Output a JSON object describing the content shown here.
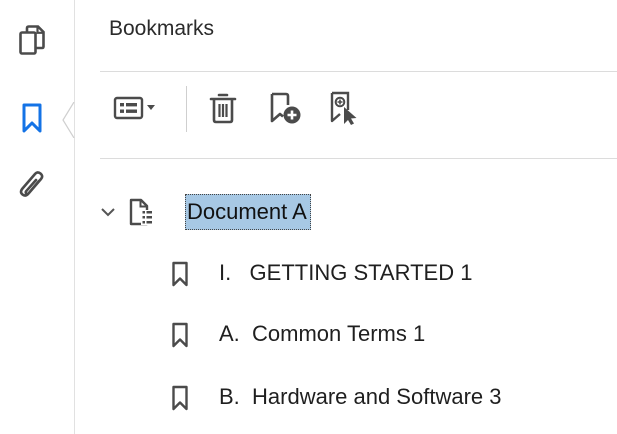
{
  "panel": {
    "title": "Bookmarks"
  },
  "rail": {
    "items": [
      {
        "icon": "page-thumbnails-icon"
      },
      {
        "icon": "bookmark-icon",
        "active": true
      },
      {
        "icon": "attachment-icon"
      }
    ]
  },
  "toolbar": {
    "items": [
      {
        "icon": "options-menu-icon"
      },
      {
        "icon": "delete-icon"
      },
      {
        "icon": "new-bookmark-icon"
      },
      {
        "icon": "find-bookmark-icon"
      }
    ]
  },
  "tree": {
    "root": {
      "label": "Document A",
      "expanded": true,
      "selected": true
    },
    "children": [
      {
        "label": "I.   GETTING STARTED 1"
      },
      {
        "label": "A.  Common Terms 1"
      },
      {
        "label": "B.  Hardware and Software 3"
      }
    ]
  },
  "colors": {
    "accent": "#1473e6",
    "selection": "#a7c8e4",
    "icon": "#4b4b4b"
  }
}
